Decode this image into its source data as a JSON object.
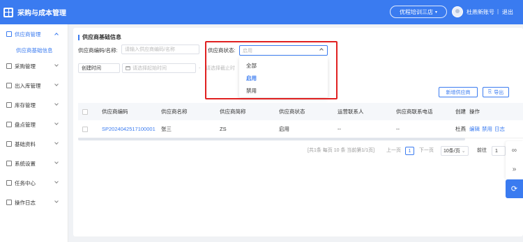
{
  "header": {
    "app_title": "采购与成本管理",
    "store_select": "优程培训三店",
    "account_name": "杜燕新账号",
    "separator": "|",
    "logout_label": "退出"
  },
  "sidebar": {
    "items": [
      {
        "label": "供应商管理",
        "active": true,
        "icon": "supplier-icon"
      },
      {
        "label": "采购管理",
        "icon": "cart-icon"
      },
      {
        "label": "出入库管理",
        "icon": "warehouse-icon"
      },
      {
        "label": "库存管理",
        "icon": "inventory-icon"
      },
      {
        "label": "盘点管理",
        "icon": "stocktake-icon"
      },
      {
        "label": "基础资料",
        "icon": "database-icon"
      },
      {
        "label": "系统设置",
        "icon": "gear-icon"
      },
      {
        "label": "任务中心",
        "icon": "task-icon"
      },
      {
        "label": "操作日志",
        "icon": "log-icon"
      }
    ],
    "submenu": {
      "label": "供应商基础信息"
    }
  },
  "page": {
    "title": "供应商基础信息"
  },
  "filters": {
    "code_label": "供应商编码/名称:",
    "code_placeholder": "请输入供应商编码/名称",
    "status_label": "供应商状态:",
    "status_value": "启用",
    "date_type": "创建时间",
    "start_placeholder": "请选择起始时间",
    "end_placeholder": "请选择截止时"
  },
  "dropdown": {
    "options": [
      "全部",
      "启用",
      "禁用"
    ],
    "selected": "启用"
  },
  "actions": {
    "add_label": "新增供应商",
    "export_label": "导出"
  },
  "table": {
    "headers": [
      "供应商编码",
      "供应商名称",
      "供应商简称",
      "供应商状态",
      "运营联系人",
      "供应商联系电话",
      "创建",
      "操作"
    ],
    "rows": [
      {
        "code": "SP2024042517100001",
        "name": "张三",
        "short": "ZS",
        "status": "启用",
        "contact": "--",
        "phone": "--",
        "created": "杜燕",
        "actions": [
          "编辑",
          "禁用",
          "日志"
        ]
      }
    ]
  },
  "pagination": {
    "summary": "[共1条 每页 10 条 当前第1/1页]",
    "prev": "上一页",
    "current": "1",
    "next": "下一页",
    "page_size": "10条/页",
    "jump_label": "前往",
    "jump_value": "1"
  },
  "colors": {
    "primary": "#3a7bf0",
    "highlight": "#e02020"
  }
}
